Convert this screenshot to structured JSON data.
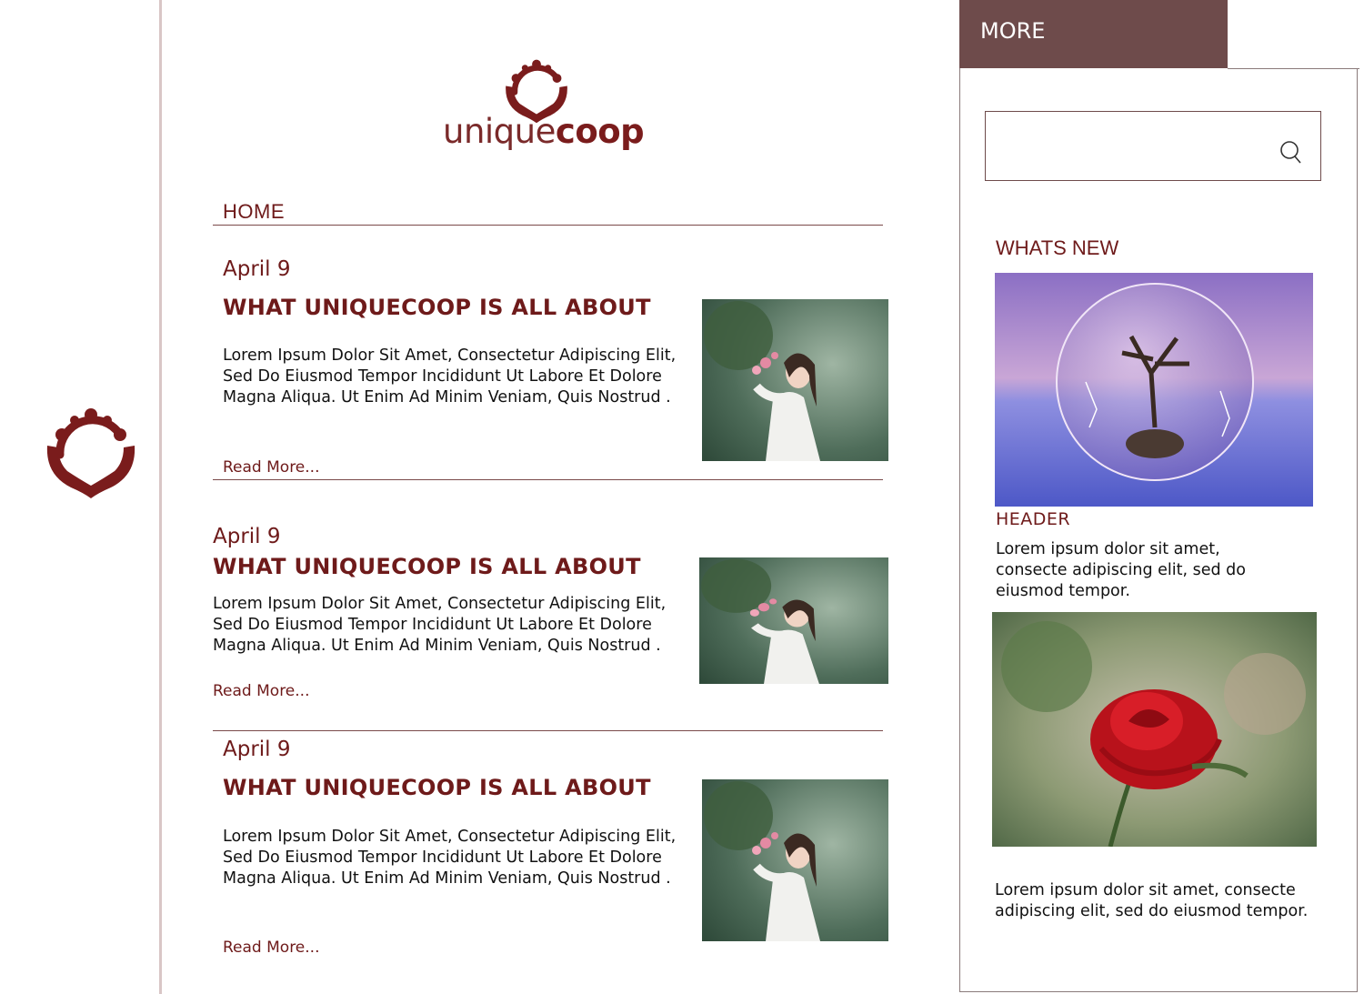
{
  "brand": {
    "name_light": "unique",
    "name_bold": "coop",
    "logo_icon": "hands-circle-logo-icon",
    "accent_color": "#6e1a1a",
    "tab_color": "#6e4b4b"
  },
  "nav": {
    "home_label": "HOME"
  },
  "posts": [
    {
      "date": "April 9",
      "title": "WHAT UNIQUECOOP IS ALL ABOUT",
      "body": "Lorem Ipsum Dolor Sit Amet, Consectetur Adipiscing Elit, Sed Do Eiusmod Tempor Incididunt Ut Labore Et Dolore Magna Aliqua. Ut Enim Ad Minim Veniam, Quis Nostrud .",
      "read_more": "Read More..."
    },
    {
      "date": "April 9",
      "title": "WHAT UNIQUECOOP IS ALL ABOUT",
      "body": "Lorem Ipsum Dolor Sit Amet, Consectetur Adipiscing Elit, Sed Do Eiusmod Tempor Incididunt Ut Labore Et Dolore Magna Aliqua. Ut Enim Ad Minim Veniam, Quis Nostrud .",
      "read_more": "Read More..."
    },
    {
      "date": "April 9",
      "title": "WHAT UNIQUECOOP IS ALL ABOUT",
      "body": "Lorem Ipsum Dolor Sit Amet, Consectetur Adipiscing Elit, Sed Do Eiusmod Tempor Incididunt Ut Labore Et Dolore Magna Aliqua. Ut Enim Ad Minim Veniam, Quis Nostrud .",
      "read_more": "Read More..."
    }
  ],
  "sidebar": {
    "tab_label": "MORE",
    "search": {
      "placeholder": "",
      "icon": "search-icon"
    },
    "whats_new_label": "WHATS NEW",
    "feature_header": "HEADER",
    "feature_text": "Lorem ipsum dolor sit amet, consecte adipiscing elit, sed do eiusmod tempor.",
    "second_text": "Lorem ipsum dolor sit amet, consecte adipiscing elit, sed do eiusmod tempor."
  }
}
